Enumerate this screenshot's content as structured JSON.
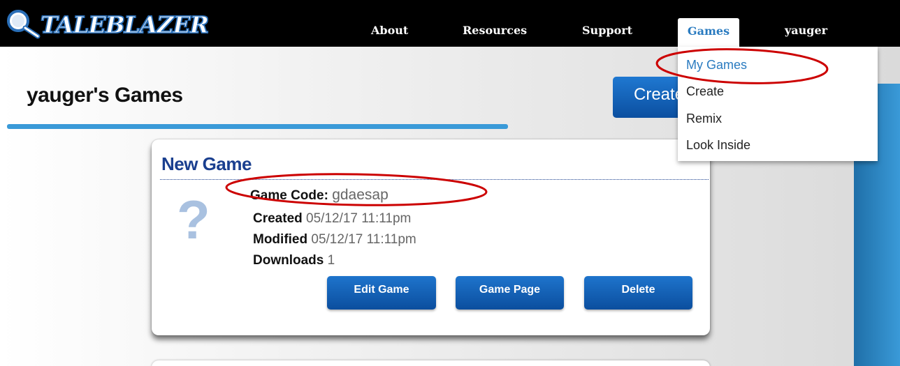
{
  "header": {
    "logo_text": "TALEBLAZER",
    "nav": {
      "about": "About",
      "resources": "Resources",
      "support": "Support",
      "games": "Games",
      "user": "yauger"
    }
  },
  "dropdown": {
    "items": [
      "My Games",
      "Create",
      "Remix",
      "Look Inside"
    ],
    "active_index": 0
  },
  "page": {
    "title": "yauger's Games",
    "create_button": "Create"
  },
  "game_card": {
    "title": "New Game",
    "placeholder_icon": "question-mark-icon",
    "code_label": "Game Code:",
    "code_value": "gdaesap",
    "created_label": "Created",
    "created_value": "05/12/17 11:11pm",
    "modified_label": "Modified",
    "modified_value": "05/12/17 11:11pm",
    "downloads_label": "Downloads",
    "downloads_value": "1",
    "buttons": {
      "edit": "Edit Game",
      "page": "Game Page",
      "delete": "Delete"
    }
  },
  "colors": {
    "accent": "#2a7bc0",
    "nav_bg": "#000000",
    "button": "#0b4fa0",
    "title_blue": "#1a3f8f",
    "annotation": "#cc0000"
  }
}
